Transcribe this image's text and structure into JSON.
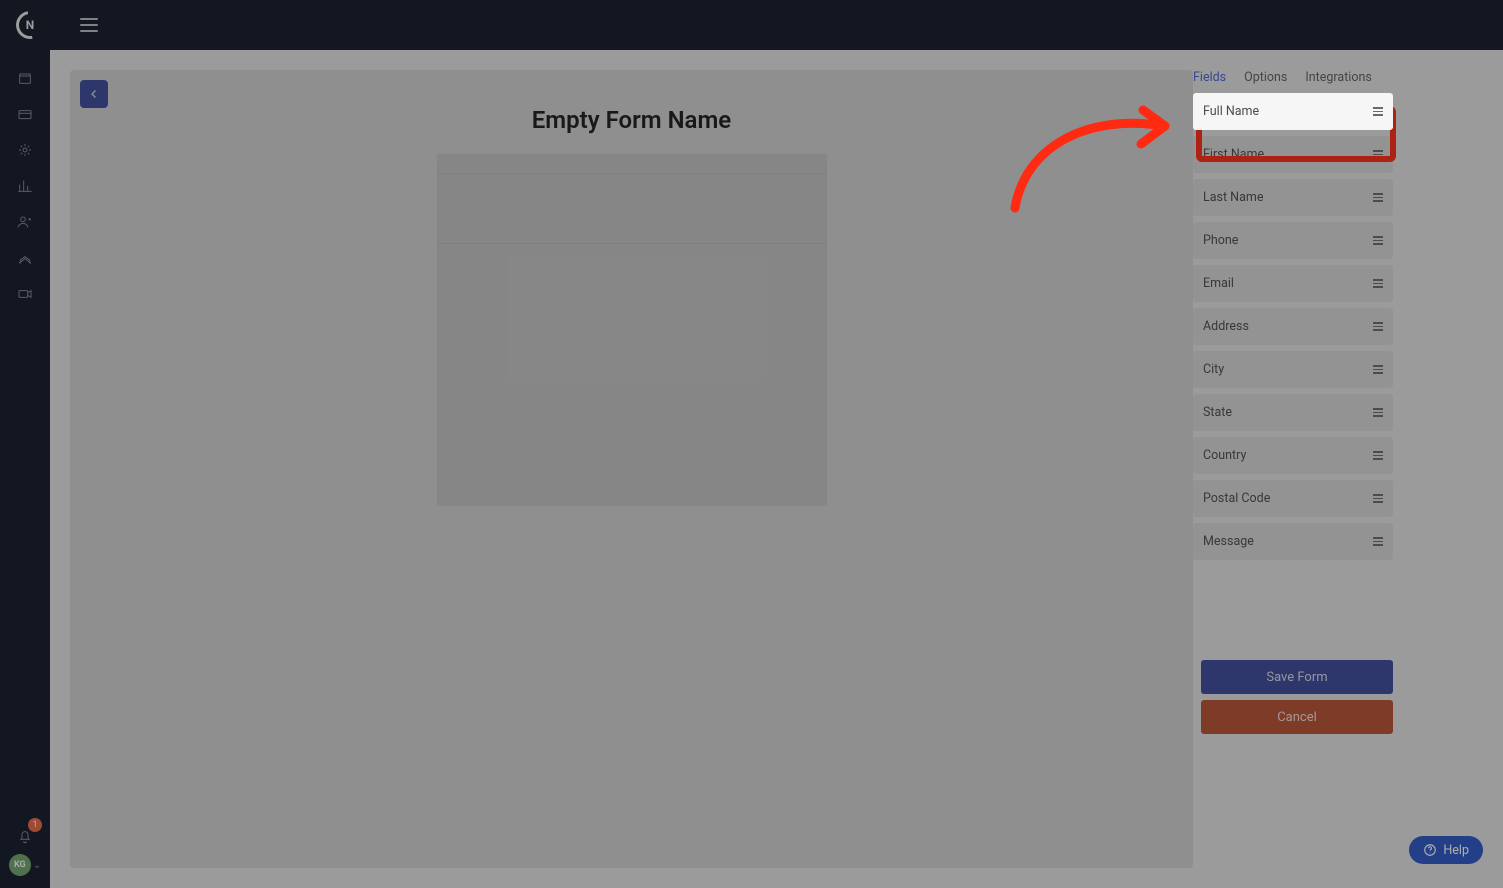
{
  "topbar": {},
  "sidebar": {
    "notification_count": "1",
    "avatar_initials": "KG"
  },
  "form": {
    "title": "Empty Form Name"
  },
  "panel": {
    "tabs": [
      {
        "label": "Fields",
        "active": true
      },
      {
        "label": "Options",
        "active": false
      },
      {
        "label": "Integrations",
        "active": false
      }
    ],
    "fields": [
      {
        "label": "Full Name",
        "highlighted": true
      },
      {
        "label": "First Name"
      },
      {
        "label": "Last Name"
      },
      {
        "label": "Phone"
      },
      {
        "label": "Email"
      },
      {
        "label": "Address"
      },
      {
        "label": "City"
      },
      {
        "label": "State"
      },
      {
        "label": "Country"
      },
      {
        "label": "Postal Code"
      },
      {
        "label": "Message"
      }
    ],
    "save_label": "Save Form",
    "cancel_label": "Cancel"
  },
  "help": {
    "label": "Help"
  },
  "annotation": {
    "highlight_color": "#ff2a12",
    "arrow_color": "#ff2a12"
  }
}
